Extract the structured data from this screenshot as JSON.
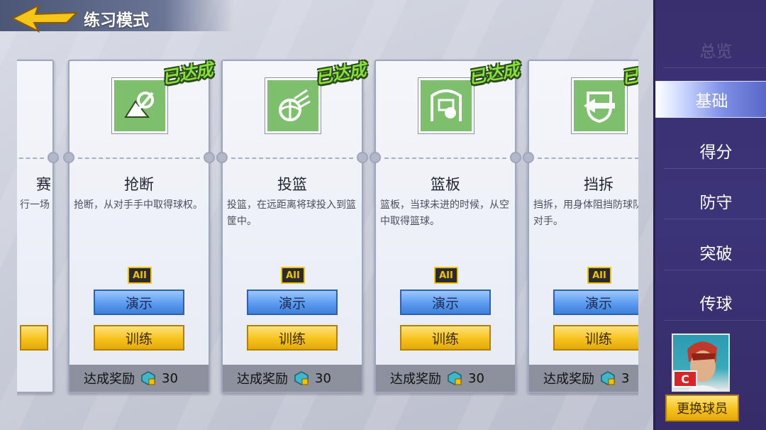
{
  "header": {
    "title": "练习模式"
  },
  "partial_card": {
    "title": "赛",
    "desc": "行一场"
  },
  "cards": [
    {
      "title": "抢断",
      "desc": "抢断，从对手手中取得球权。",
      "level": "AII",
      "demo": "演示",
      "train": "训练",
      "reward_label": "达成奖励",
      "reward_value": "30",
      "done": "已达成",
      "icon": "steal-icon"
    },
    {
      "title": "投篮",
      "desc": "投篮，在远距离将球投入到篮筐中。",
      "level": "AII",
      "demo": "演示",
      "train": "训练",
      "reward_label": "达成奖励",
      "reward_value": "30",
      "done": "已达成",
      "icon": "basketball-shot-icon"
    },
    {
      "title": "篮板",
      "desc": "篮板，当球未进的时候，从空中取得篮球。",
      "level": "AII",
      "demo": "演示",
      "train": "训练",
      "reward_label": "达成奖励",
      "reward_value": "30",
      "done": "已达成",
      "icon": "rebound-icon"
    },
    {
      "title": "挡拆",
      "desc": "挡拆，用身体阻挡防球队友的对手。",
      "level": "AII",
      "demo": "演示",
      "train": "训练",
      "reward_label": "达成奖励",
      "reward_value": "3",
      "done": "已达成",
      "icon": "screen-icon"
    }
  ],
  "sidebar": {
    "items": [
      {
        "label": "总览"
      },
      {
        "label": "基础"
      },
      {
        "label": "得分"
      },
      {
        "label": "防守"
      },
      {
        "label": "突破"
      },
      {
        "label": "传球"
      }
    ],
    "active_index": 1,
    "swap_button": "更换球员",
    "avatar_badge": "C"
  }
}
